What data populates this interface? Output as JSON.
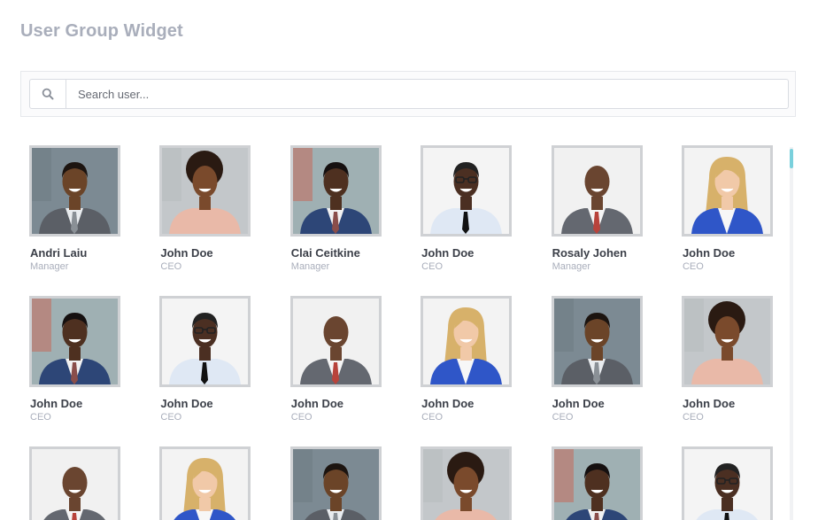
{
  "page": {
    "title": "User Group Widget"
  },
  "search": {
    "placeholder": "Search user...",
    "value": "",
    "icon": "search-icon"
  },
  "users": [
    {
      "name": "Andri Laiu",
      "role": "Manager",
      "photo": "p1"
    },
    {
      "name": "John Doe",
      "role": "CEO",
      "photo": "p2"
    },
    {
      "name": "Clai Ceitkine",
      "role": "Manager",
      "photo": "p3"
    },
    {
      "name": "John Doe",
      "role": "CEO",
      "photo": "p4"
    },
    {
      "name": "Rosaly Johen",
      "role": "Manager",
      "photo": "p5"
    },
    {
      "name": "John Doe",
      "role": "CEO",
      "photo": "p6"
    },
    {
      "name": "John Doe",
      "role": "CEO",
      "photo": "p3"
    },
    {
      "name": "John Doe",
      "role": "CEO",
      "photo": "p4"
    },
    {
      "name": "John Doe",
      "role": "CEO",
      "photo": "p5"
    },
    {
      "name": "John Doe",
      "role": "CEO",
      "photo": "p6"
    },
    {
      "name": "John Doe",
      "role": "CEO",
      "photo": "p1"
    },
    {
      "name": "John Doe",
      "role": "CEO",
      "photo": "p2"
    },
    {
      "name": "",
      "role": "",
      "photo": "p5"
    },
    {
      "name": "",
      "role": "",
      "photo": "p6"
    },
    {
      "name": "",
      "role": "",
      "photo": "p1"
    },
    {
      "name": "",
      "role": "",
      "photo": "p2"
    },
    {
      "name": "",
      "role": "",
      "photo": "p3"
    },
    {
      "name": "",
      "role": "",
      "photo": "p4"
    }
  ],
  "colors": {
    "accent": "#7ad0dc",
    "title": "#a9aebb",
    "avatar_border": "#cfd1d4"
  }
}
